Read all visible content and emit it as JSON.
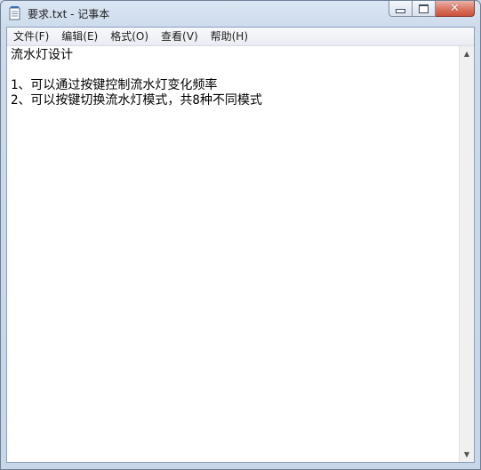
{
  "window": {
    "title": "要求.txt - 记事本",
    "icon": "notepad-icon"
  },
  "controls": {
    "minimize_icon": "minimize-icon",
    "maximize_icon": "maximize-icon",
    "close_icon": "close-icon",
    "close_glyph": "✕"
  },
  "menu": [
    {
      "label": "文件(F)"
    },
    {
      "label": "编辑(E)"
    },
    {
      "label": "格式(O)"
    },
    {
      "label": "查看(V)"
    },
    {
      "label": "帮助(H)"
    }
  ],
  "document": {
    "lines": [
      "流水灯设计",
      "",
      "1、可以通过按键控制流水灯变化频率",
      "2、可以按键切换流水灯模式，共8种不同模式"
    ]
  },
  "scrollbar": {
    "up_glyph": "▲",
    "down_glyph": "▼"
  },
  "colors": {
    "title_bar": "#cddbeb",
    "close_button": "#d86f5b",
    "editor_bg": "#ffffff"
  }
}
